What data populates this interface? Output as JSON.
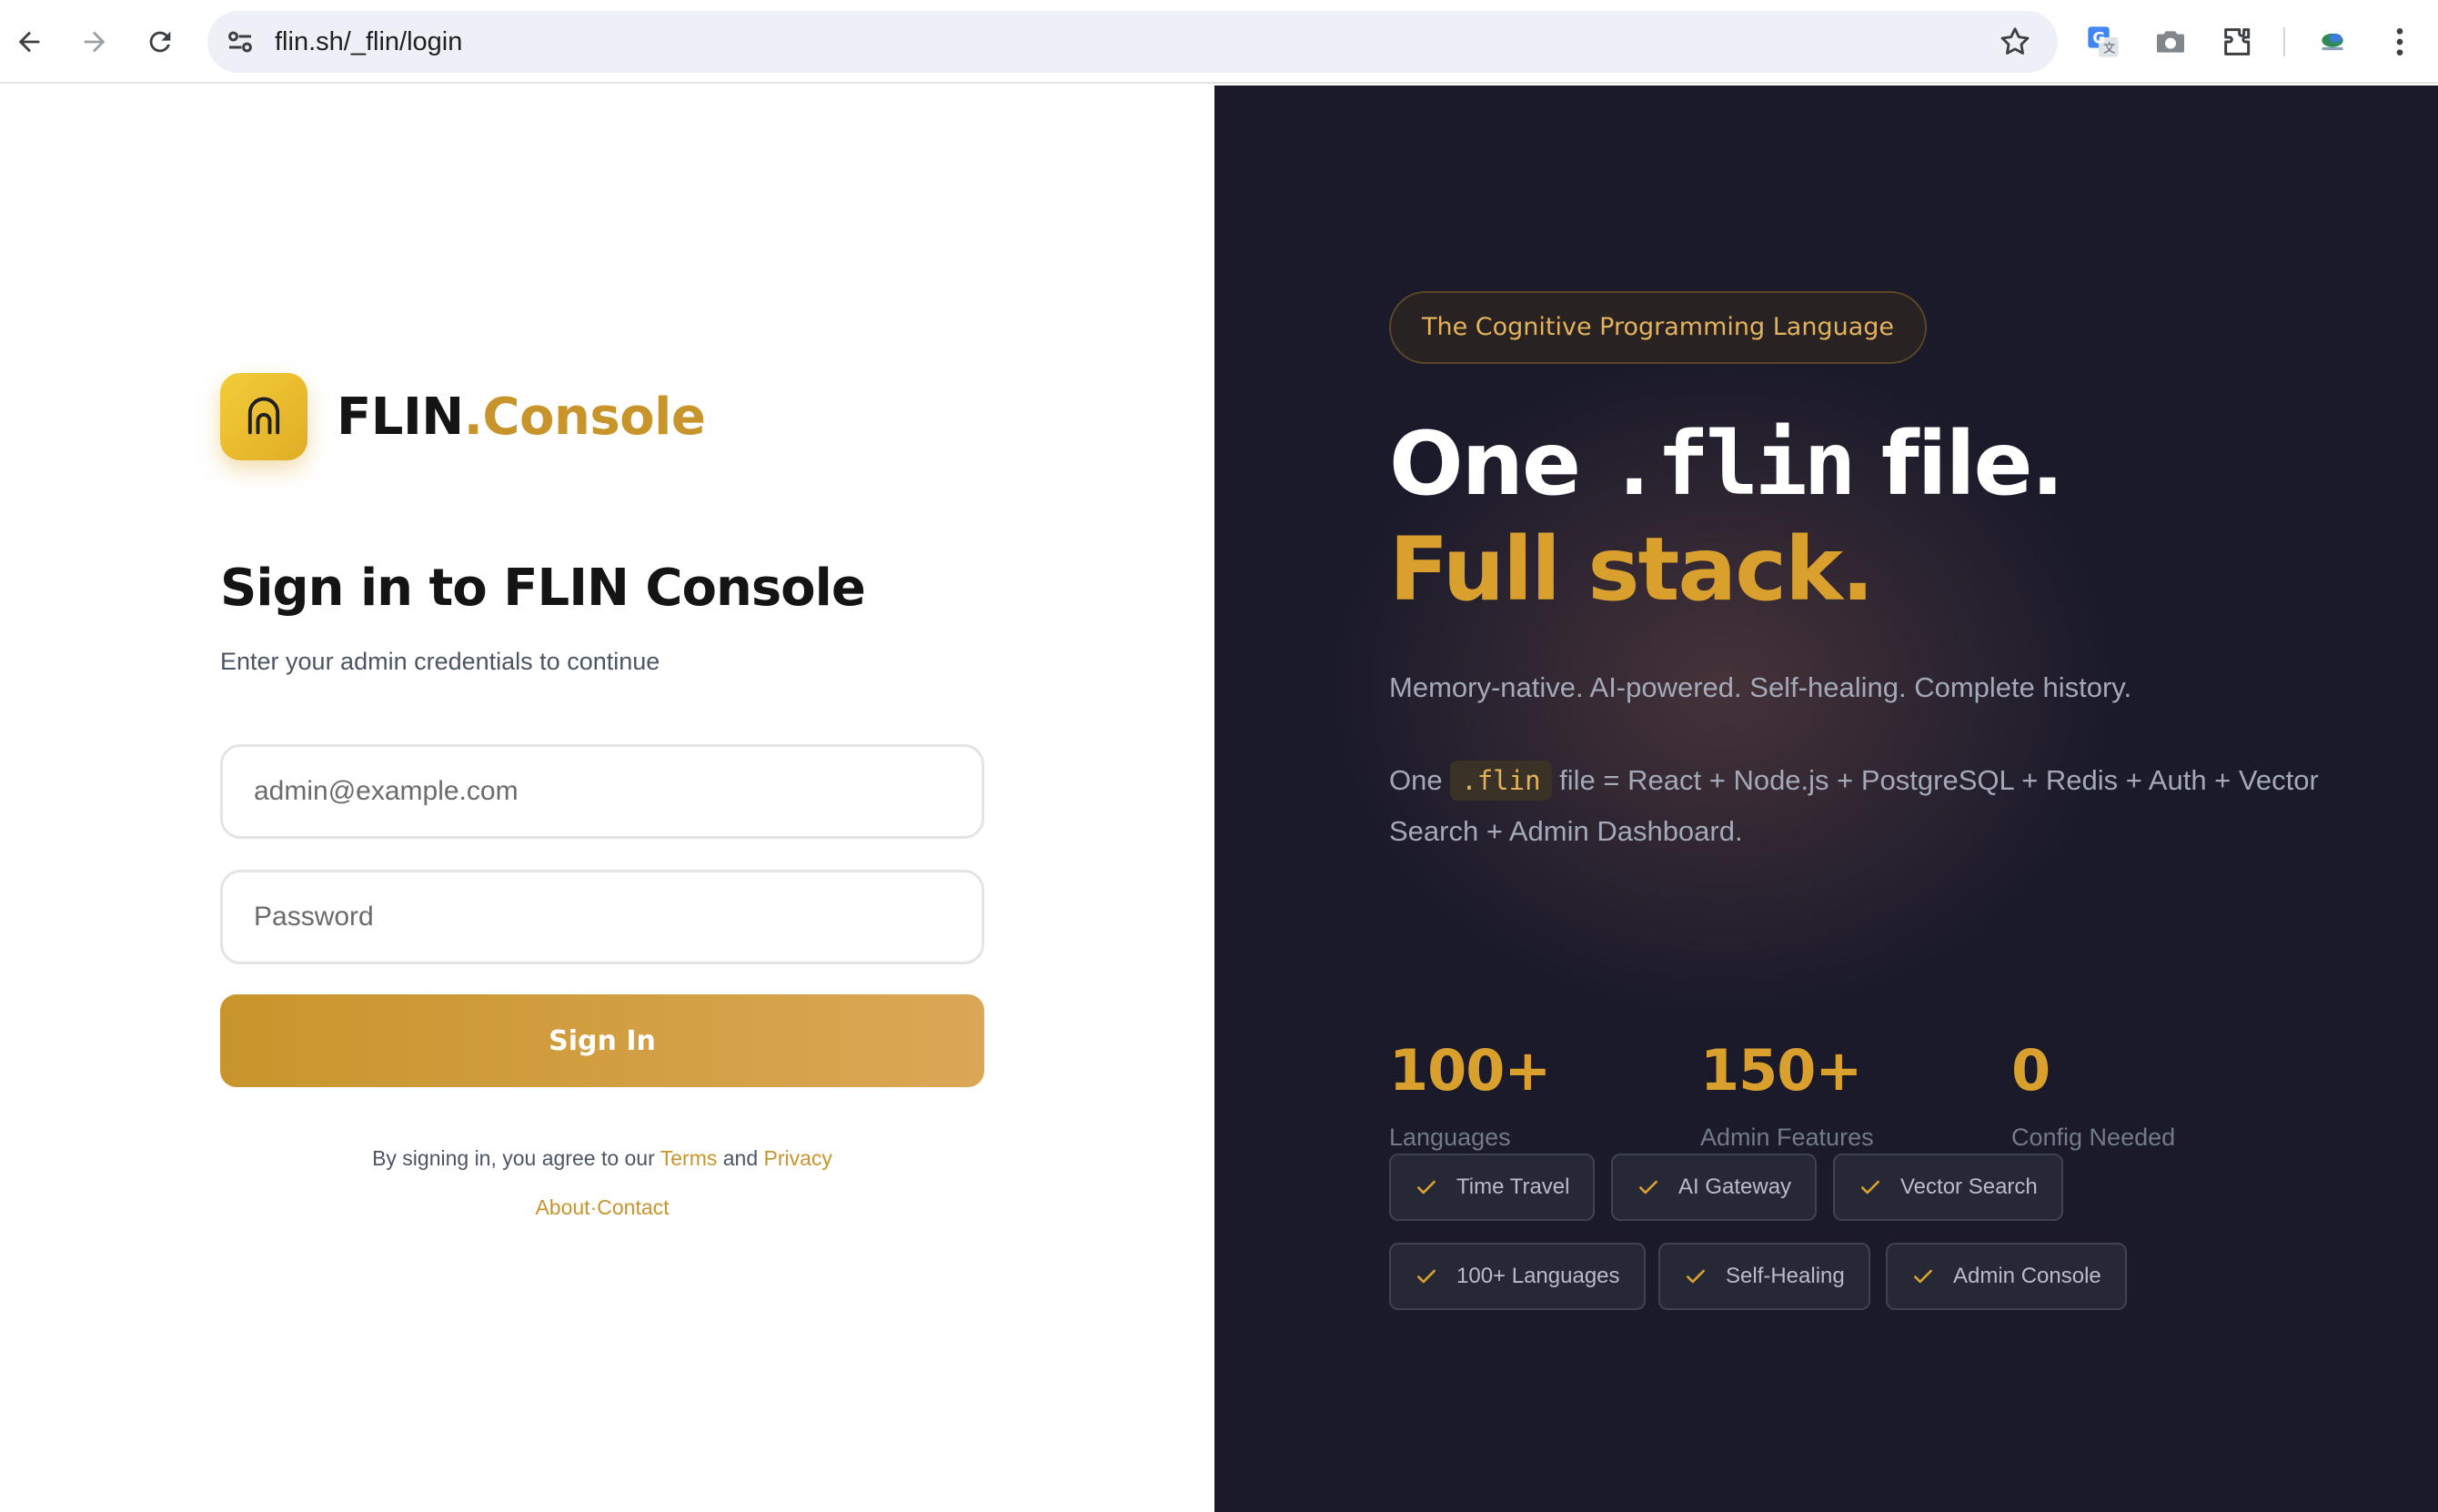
{
  "browser": {
    "url": "flin.sh/_flin/login",
    "icons": [
      "back-arrow-icon",
      "forward-arrow-icon",
      "reload-icon",
      "site-settings-icon",
      "bookmark-star-icon",
      "translate-icon",
      "camera-icon",
      "extensions-icon",
      "profile-avatar-icon",
      "kebab-menu-icon"
    ]
  },
  "brand": {
    "name_main": "FLIN",
    "name_accent": ".Console",
    "accent_color": "#c8952c"
  },
  "login": {
    "title": "Sign in to FLIN Console",
    "subtitle": "Enter your admin credentials to continue",
    "email_placeholder": "admin@example.com",
    "password_placeholder": "Password",
    "submit_label": "Sign In",
    "legal_prefix": "By signing in, you agree to our",
    "terms_label": "Terms",
    "and_label": "and",
    "privacy_label": "Privacy",
    "about_label": "About",
    "separator": "·",
    "contact_label": "Contact"
  },
  "hero": {
    "pill": "The Cognitive Programming Language",
    "line1_prefix": "One",
    "line1_code": ".flin",
    "line1_suffix": "file.",
    "line2": "Full stack.",
    "tagline": "Memory-native. AI-powered. Self-healing. Complete history.",
    "desc_prefix": "One",
    "desc_code": ".flin",
    "desc_suffix": "file = React + Node.js + PostgreSQL + Redis + Auth + Vector Search + Admin Dashboard.",
    "stats": [
      {
        "value": "100+",
        "label": "Languages"
      },
      {
        "value": "150+",
        "label": "Admin Features"
      },
      {
        "value": "0",
        "label": "Config Needed"
      }
    ],
    "features": [
      "Time Travel",
      "AI Gateway",
      "Vector Search",
      "100+ Languages",
      "Self-Healing",
      "Admin Console"
    ],
    "colors": {
      "background": "#1a1a2a",
      "gold": "#d9a02e",
      "muted": "#a3a9b8"
    }
  }
}
